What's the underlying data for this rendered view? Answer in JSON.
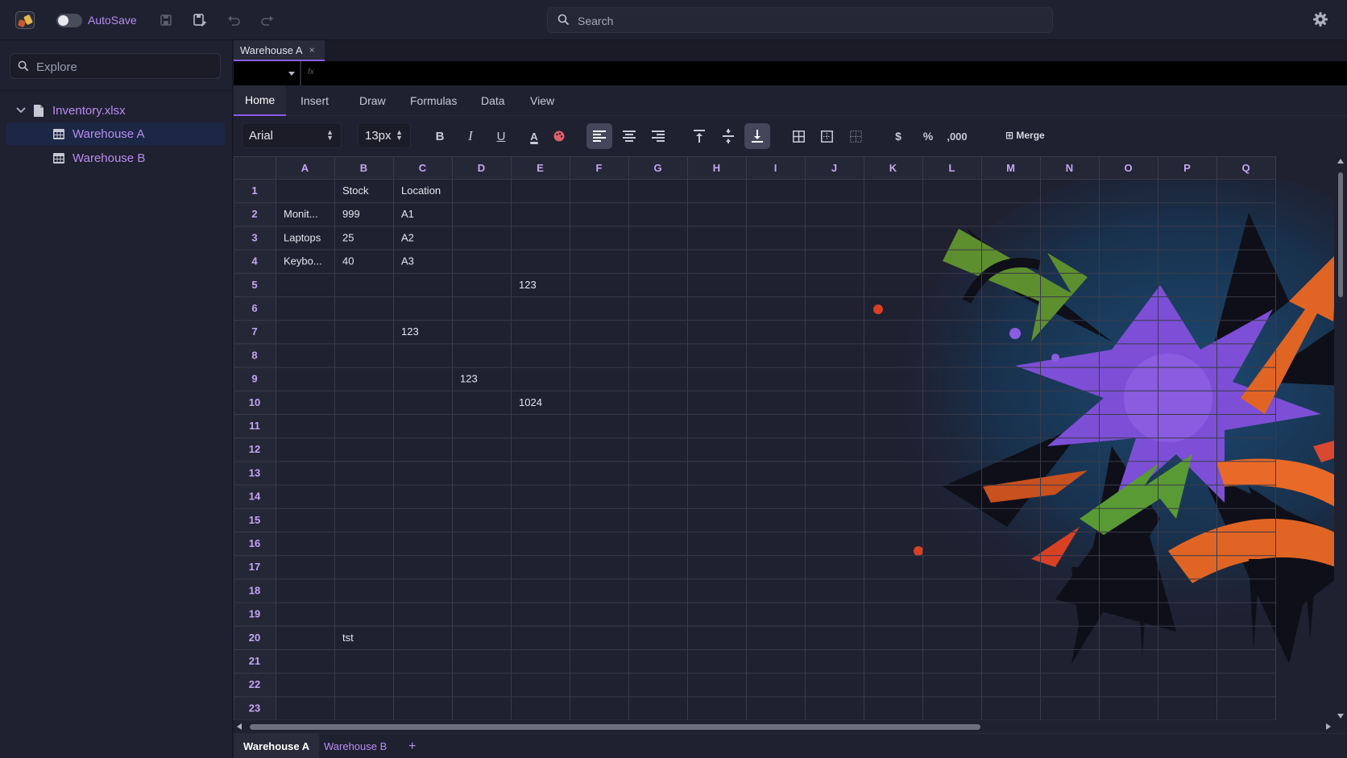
{
  "topbar": {
    "autosave_label": "AutoSave",
    "autosave_on": false,
    "search_placeholder": "Search",
    "icons": [
      "app-logo-icon",
      "save-icon",
      "save-as-icon",
      "undo-icon",
      "redo-icon",
      "search-icon",
      "gear-icon"
    ]
  },
  "sidebar": {
    "explore_placeholder": "Explore",
    "file_name": "Inventory.xlsx",
    "sheets": [
      "Warehouse A",
      "Warehouse B"
    ],
    "selected_sheet": "Warehouse A"
  },
  "doc_tab": {
    "label": "Warehouse A",
    "close": "×"
  },
  "formula_bar": {
    "fx": "fx",
    "namebox": ""
  },
  "ribbon": {
    "tabs": [
      "Home",
      "Insert",
      "Draw",
      "Formulas",
      "Data",
      "View"
    ],
    "active": "Home"
  },
  "toolbar": {
    "font": "Arial",
    "size": "13px",
    "bold": "B",
    "italic": "I",
    "underline": "U",
    "text_color": "A",
    "currency": "$",
    "percent": "%",
    "thousands": ",000",
    "merge": "Merge"
  },
  "grid": {
    "columns": [
      "A",
      "B",
      "C",
      "D",
      "E",
      "F",
      "G",
      "H",
      "I",
      "J",
      "K",
      "L",
      "M",
      "N",
      "O",
      "P",
      "Q"
    ],
    "rows": [
      "1",
      "2",
      "3",
      "4",
      "5",
      "6",
      "7",
      "8",
      "9",
      "10",
      "11",
      "12",
      "13",
      "14",
      "15",
      "16",
      "17",
      "18",
      "19",
      "20",
      "21",
      "22",
      "23"
    ],
    "cells": [
      {
        "r": 1,
        "c": 1,
        "v": "Stock"
      },
      {
        "r": 1,
        "c": 2,
        "v": "Location"
      },
      {
        "r": 2,
        "c": 0,
        "v": "Monit..."
      },
      {
        "r": 2,
        "c": 1,
        "v": "999"
      },
      {
        "r": 2,
        "c": 2,
        "v": "A1"
      },
      {
        "r": 3,
        "c": 0,
        "v": "Laptops"
      },
      {
        "r": 3,
        "c": 1,
        "v": "25"
      },
      {
        "r": 3,
        "c": 2,
        "v": "A2"
      },
      {
        "r": 4,
        "c": 0,
        "v": "Keybo..."
      },
      {
        "r": 4,
        "c": 1,
        "v": "40"
      },
      {
        "r": 4,
        "c": 2,
        "v": "A3"
      },
      {
        "r": 5,
        "c": 4,
        "v": "123"
      },
      {
        "r": 7,
        "c": 2,
        "v": "123"
      },
      {
        "r": 9,
        "c": 3,
        "v": "123"
      },
      {
        "r": 10,
        "c": 4,
        "v": "1024"
      },
      {
        "r": 20,
        "c": 1,
        "v": "tst"
      }
    ]
  },
  "sheet_tabs": {
    "tabs": [
      "Warehouse A",
      "Warehouse B"
    ],
    "active": "Warehouse A",
    "add": "+"
  },
  "colors": {
    "accent": "#8a5cf0",
    "link": "#b88df2",
    "bg": "#1d1e2b",
    "panel": "#1f2030"
  }
}
